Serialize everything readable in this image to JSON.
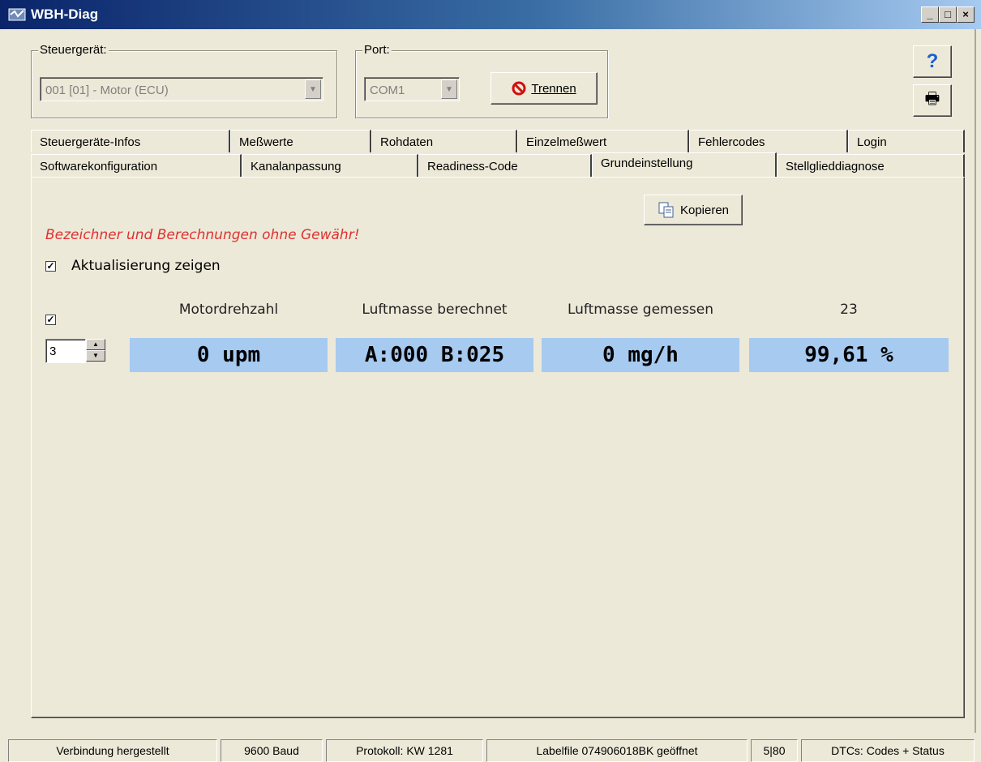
{
  "window": {
    "title": "WBH-Diag",
    "minimize": "_",
    "maximize": "□",
    "close": "×"
  },
  "controller_group": {
    "label": "Steuergerät:",
    "value": "001 [01] - Motor (ECU)"
  },
  "port_group": {
    "label": "Port:",
    "value": "COM1",
    "disconnect_label": "Trennen"
  },
  "side_buttons": {
    "help": "?",
    "print": "🖶"
  },
  "tabs_row1": [
    "Steuergeräte-Infos",
    "Meßwerte",
    "Rohdaten",
    "Einzelmeßwert",
    "Fehlercodes",
    "Login"
  ],
  "tabs_row2": [
    "Softwarekonfiguration",
    "Kanalanpassung",
    "Readiness-Code",
    "Grundeinstellung",
    "Stellglieddiagnose"
  ],
  "active_tab": "Grundeinstellung",
  "panel": {
    "copy_button": "Kopieren",
    "warning": "Bezeichner und Berechnungen ohne Gewähr!",
    "show_update_label": "Aktualisierung zeigen",
    "show_update_checked": true,
    "group_checked": true,
    "group_number": "3",
    "columns": [
      {
        "header": "Motordrehzahl",
        "value": "0 upm"
      },
      {
        "header": "Luftmasse berechnet",
        "value": "A:000 B:025"
      },
      {
        "header": "Luftmasse gemessen",
        "value": "0 mg/h"
      },
      {
        "header": "23",
        "value": "99,61 %"
      }
    ]
  },
  "statusbar": [
    "Verbindung hergestellt",
    "9600 Baud",
    "Protokoll: KW 1281",
    "Labelfile 074906018BK geöffnet",
    "5|80",
    "DTCs: Codes + Status"
  ],
  "colors": {
    "value_cell": "#A6CAF0",
    "warning": "#E03030",
    "title_start": "#0A246A"
  }
}
